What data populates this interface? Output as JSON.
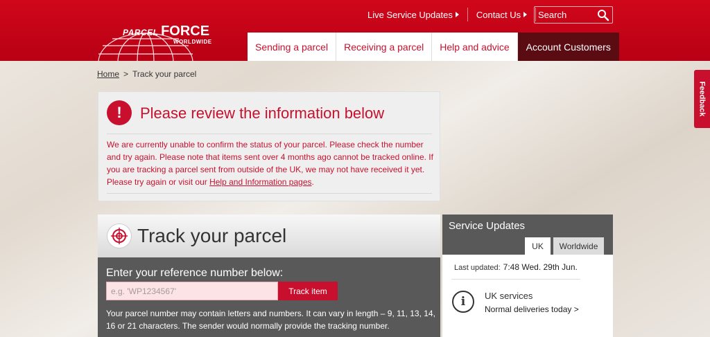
{
  "header": {
    "logo": {
      "brand_left": "PARCEL",
      "brand_right": "FORCE",
      "subtitle": "WORLDWIDE"
    },
    "top_links": [
      "Live Service Updates",
      "Contact Us"
    ],
    "search": {
      "label": "Search",
      "icon": "search-icon"
    },
    "nav": [
      "Sending a parcel",
      "Receiving a parcel",
      "Help and advice",
      "Account Customers"
    ],
    "colors": {
      "brand_red": "#c8102e",
      "nav_dark": "#5a0c12"
    }
  },
  "breadcrumb": {
    "home": "Home",
    "separator": ">",
    "current": "Track your parcel"
  },
  "alert": {
    "title": "Please review the information below",
    "body": "We are currently unable to confirm the status of your parcel. Please check the number and try again. Please note that items sent over 4 months ago cannot be tracked online. If you are tracking a parcel sent from outside of the UK, we may not have received it yet. Please try again or visit our ",
    "link": "Help and Information pages",
    "tail": "."
  },
  "track": {
    "title": "Track your parcel",
    "label": "Enter your reference number below:",
    "placeholder": "e.g. 'WP1234567'",
    "button": "Track item",
    "help": "Your parcel number may contain letters and numbers. It can vary in length – 9, 11, 13, 14, 16 or 21 characters. The sender would normally provide the tracking number."
  },
  "service_updates": {
    "title": "Service Updates",
    "tabs": [
      "UK",
      "Worldwide"
    ],
    "last_updated_label": "Last updated:",
    "last_updated_value": "7:48 Wed. 29th Jun.",
    "uk_title": "UK services",
    "uk_status": "Normal deliveries today",
    "uk_chevron": ">"
  },
  "feedback": "Feedback"
}
